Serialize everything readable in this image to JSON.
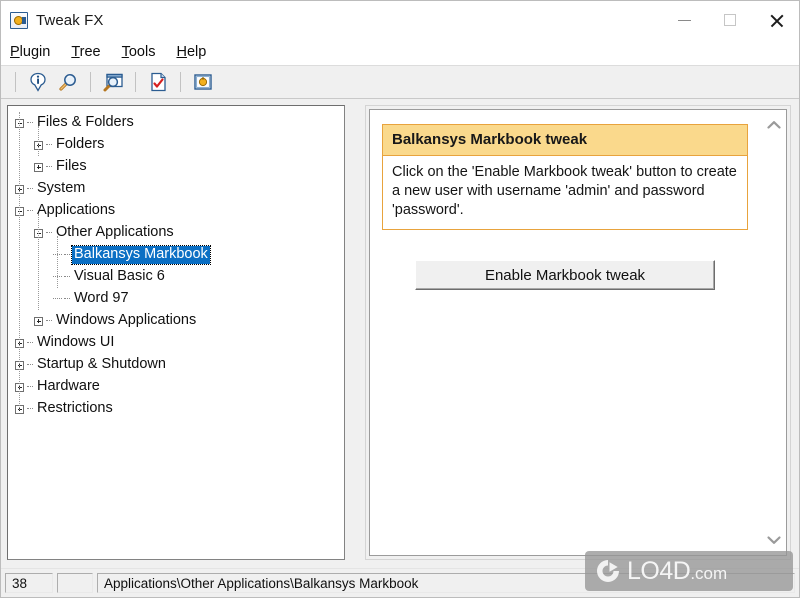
{
  "window": {
    "title": "Tweak FX",
    "app_icon": "tweakfx-app-icon",
    "controls": {
      "minimize": "minimize-icon",
      "maximize": "maximize-icon",
      "close": "close-icon"
    }
  },
  "menubar": {
    "items": [
      {
        "label": "Plugin",
        "accel": "P"
      },
      {
        "label": "Tree",
        "accel": "T"
      },
      {
        "label": "Tools",
        "accel": "T"
      },
      {
        "label": "Help",
        "accel": "H"
      }
    ]
  },
  "toolbar": {
    "buttons": [
      {
        "name": "info-icon"
      },
      {
        "name": "search-magnifier-icon"
      },
      {
        "name": "find-in-window-icon"
      },
      {
        "name": "checked-document-icon"
      },
      {
        "name": "plugin-icon"
      }
    ]
  },
  "tree": {
    "nodes": [
      {
        "label": "Files & Folders",
        "depth": 0,
        "state": "minus",
        "selected": false
      },
      {
        "label": "Folders",
        "depth": 1,
        "state": "plus",
        "selected": false
      },
      {
        "label": "Files",
        "depth": 1,
        "state": "plus",
        "selected": false
      },
      {
        "label": "System",
        "depth": 0,
        "state": "plus",
        "selected": false
      },
      {
        "label": "Applications",
        "depth": 0,
        "state": "minus",
        "selected": false
      },
      {
        "label": "Other Applications",
        "depth": 1,
        "state": "minus",
        "selected": false
      },
      {
        "label": "Balkansys Markbook",
        "depth": 2,
        "state": "leaf",
        "selected": true
      },
      {
        "label": "Visual Basic 6",
        "depth": 2,
        "state": "leaf",
        "selected": false
      },
      {
        "label": "Word 97",
        "depth": 2,
        "state": "leaf",
        "selected": false
      },
      {
        "label": "Windows Applications",
        "depth": 1,
        "state": "plus",
        "selected": false
      },
      {
        "label": "Windows UI",
        "depth": 0,
        "state": "plus",
        "selected": false
      },
      {
        "label": "Startup & Shutdown",
        "depth": 0,
        "state": "plus",
        "selected": false
      },
      {
        "label": "Hardware",
        "depth": 0,
        "state": "plus",
        "selected": false
      },
      {
        "label": "Restrictions",
        "depth": 0,
        "state": "plus",
        "selected": false
      }
    ]
  },
  "panel": {
    "info_title": "Balkansys Markbook tweak",
    "info_text": "Click on the 'Enable Markbook tweak' button to create a new user with username 'admin' and password 'password'.",
    "action_button": "Enable Markbook tweak",
    "scroll_up": "chevron-up-icon",
    "scroll_down": "chevron-down-icon"
  },
  "statusbar": {
    "count": "38",
    "middle": "",
    "path": "Applications\\Other Applications\\Balkansys Markbook"
  },
  "watermark": {
    "name": "LO4D",
    "suffix": ".com"
  },
  "colors": {
    "selection_blue": "#0b6fc4",
    "info_header_bg": "#fad98c",
    "info_border": "#e8a33d",
    "chrome_gray": "#f0f0f0"
  }
}
